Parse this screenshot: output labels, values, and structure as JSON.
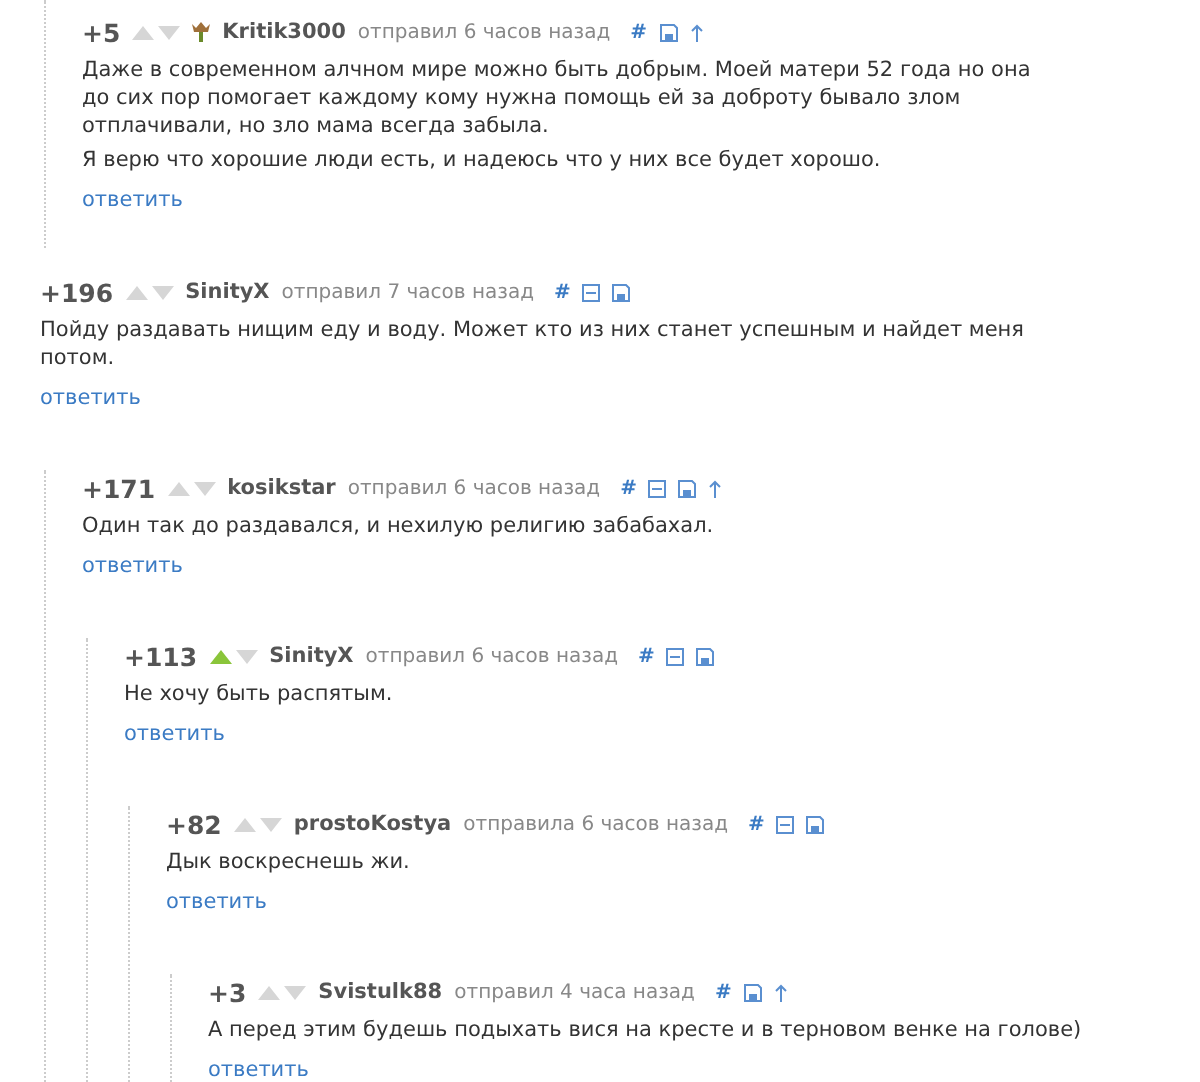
{
  "thread_tail": {
    "score": "+5",
    "upvoted": false,
    "has_badge": true,
    "author": "Kritik3000",
    "meta": "отправил 6 часов назад",
    "icons": [
      {
        "kind": "hash",
        "label": "#"
      },
      {
        "kind": "save"
      },
      {
        "kind": "up"
      }
    ],
    "paragraphs": [
      "Даже в современном алчном мире можно быть добрым. Моей матери 52 года но она до сих пор помогает каждому кому нужна помощь ей за доброту бывало злом отплачивали, но зло мама всегда забыла.",
      "Я верю что хорошие люди есть, и надеюсь что у них все будет хорошо."
    ],
    "reply": "ответить"
  },
  "comments": [
    {
      "score": "+196",
      "upvoted": false,
      "has_badge": false,
      "author": "SinityX",
      "meta": "отправил 7 часов назад",
      "icons": [
        {
          "kind": "hash",
          "label": "#"
        },
        {
          "kind": "collapse"
        },
        {
          "kind": "save"
        }
      ],
      "paragraphs": [
        "Пойду раздавать нищим еду и воду. Может кто из них станет успешным и найдет меня потом."
      ],
      "reply": "ответить",
      "children": [
        {
          "score": "+171",
          "upvoted": false,
          "has_badge": false,
          "author": "kosikstar",
          "meta": "отправил 6 часов назад",
          "icons": [
            {
              "kind": "hash",
              "label": "#"
            },
            {
              "kind": "collapse"
            },
            {
              "kind": "save"
            },
            {
              "kind": "up"
            }
          ],
          "paragraphs": [
            "Один так до раздавался, и нехилую религию забабахал."
          ],
          "reply": "ответить",
          "children": [
            {
              "score": "+113",
              "upvoted": true,
              "has_badge": false,
              "author": "SinityX",
              "meta": "отправил 6 часов назад",
              "icons": [
                {
                  "kind": "hash",
                  "label": "#"
                },
                {
                  "kind": "collapse"
                },
                {
                  "kind": "save"
                }
              ],
              "paragraphs": [
                "Не хочу быть распятым."
              ],
              "reply": "ответить",
              "children": [
                {
                  "score": "+82",
                  "upvoted": false,
                  "has_badge": false,
                  "author": "prostoKostya",
                  "meta": "отправила 6 часов назад",
                  "icons": [
                    {
                      "kind": "hash",
                      "label": "#"
                    },
                    {
                      "kind": "collapse"
                    },
                    {
                      "kind": "save"
                    }
                  ],
                  "paragraphs": [
                    "Дык воскреснешь жи."
                  ],
                  "reply": "ответить",
                  "children": [
                    {
                      "score": "+3",
                      "upvoted": false,
                      "has_badge": false,
                      "author": "Svistulk88",
                      "meta": "отправил 4 часа назад",
                      "icons": [
                        {
                          "kind": "hash",
                          "label": "#"
                        },
                        {
                          "kind": "save"
                        },
                        {
                          "kind": "up"
                        }
                      ],
                      "paragraphs": [
                        "А перед этим будешь подыхать вися на кресте и в терновом венке на голове)"
                      ],
                      "reply": "ответить"
                    }
                  ]
                }
              ]
            }
          ]
        }
      ]
    }
  ]
}
